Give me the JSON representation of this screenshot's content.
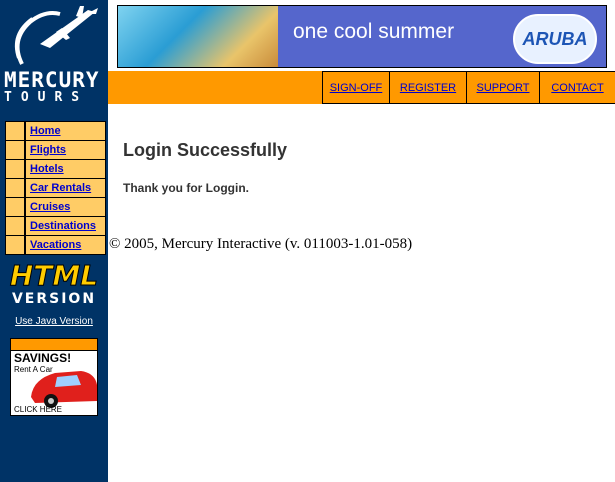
{
  "logo": {
    "line1": "MERCURY",
    "line2": "TOURS"
  },
  "banner": {
    "tagline": "one cool summer",
    "badge": "ARUBA"
  },
  "top_nav": [
    "SIGN-OFF",
    "REGISTER",
    "SUPPORT",
    "CONTACT"
  ],
  "side_nav": [
    "Home",
    "Flights",
    "Hotels",
    "Car Rentals",
    "Cruises",
    "Destinations",
    "Vacations"
  ],
  "version": {
    "big": "HTML",
    "small": "VERSION",
    "link": "Use Java Version"
  },
  "ad": {
    "title": "SAVINGS!",
    "subtitle": "Rent A Car",
    "cta": "CLICK HERE"
  },
  "content": {
    "title": "Login Successfully",
    "message": "Thank you for Loggin."
  },
  "footer": "© 2005, Mercury Interactive (v. 011003-1.01-058)",
  "colors": {
    "sidebar": "#003366",
    "orange": "#ff9900",
    "nav_cell": "#ffcc66",
    "link": "#0000cc"
  }
}
